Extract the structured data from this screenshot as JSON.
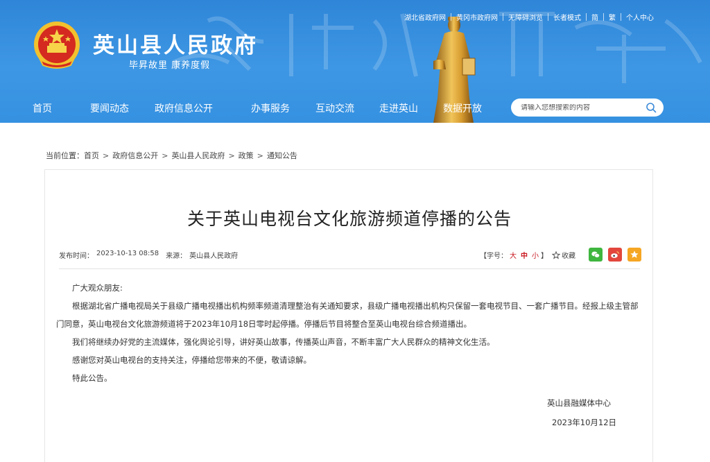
{
  "header": {
    "site_title": "英山县人民政府",
    "slogan": "毕昇故里 康养度假",
    "top_links": [
      "湖北省政府网",
      "黄冈市政府网",
      "无障碍浏览",
      "长者模式",
      "简",
      "繁",
      "个人中心"
    ],
    "nav": [
      "首页",
      "要闻动态",
      "政府信息公开",
      "办事服务",
      "互动交流",
      "走进英山",
      "数据开放"
    ],
    "search_placeholder": "请输入您想搜索的内容"
  },
  "breadcrumb": {
    "prefix": "当前位置：",
    "items": [
      "首页",
      "政府信息公开",
      "英山县人民政府",
      "政策",
      "通知公告"
    ]
  },
  "article": {
    "title": "关于英山电视台文化旅游频道停播的公告",
    "publish_label": "发布时间：",
    "publish_time": "2023-10-13 08:58",
    "source_label": "来源：",
    "source": "英山县人民政府",
    "font_size_label": "【字号：",
    "font_sizes": [
      "大",
      "中",
      "小"
    ],
    "font_size_close": "】",
    "favorite_label": "收藏",
    "greeting": "广大观众朋友:",
    "paragraphs": [
      "根据湖北省广播电视局关于县级广播电视播出机构频率频道清理整治有关通知要求，县级广播电视播出机构只保留一套电视节目、一套广播节目。经报上级主管部门同意，英山电视台文化旅游频道将于2023年10月18日零时起停播。停播后节目将整合至英山电视台综合频道播出。",
      "我们将继续办好党的主流媒体，强化舆论引导，讲好英山故事，传播英山声音，不断丰富广大人民群众的精神文化生活。",
      "感谢您对英山电视台的支持关注，停播给您带来的不便，敬请谅解。",
      "特此公告。"
    ],
    "signature": "英山县融媒体中心",
    "sign_date": "2023年10月12日"
  },
  "icons": {
    "share_wechat": "wechat-icon",
    "share_weibo": "weibo-icon",
    "share_qzone": "qzone-icon",
    "favorite": "star-icon",
    "search": "search-icon",
    "emblem": "national-emblem-icon"
  },
  "colors": {
    "banner_blue": "#3591e1",
    "accent_red": "#c8161e",
    "wechat_green": "#3fb63f",
    "weibo_red": "#e2463c",
    "qzone_orange": "#f5a623"
  }
}
